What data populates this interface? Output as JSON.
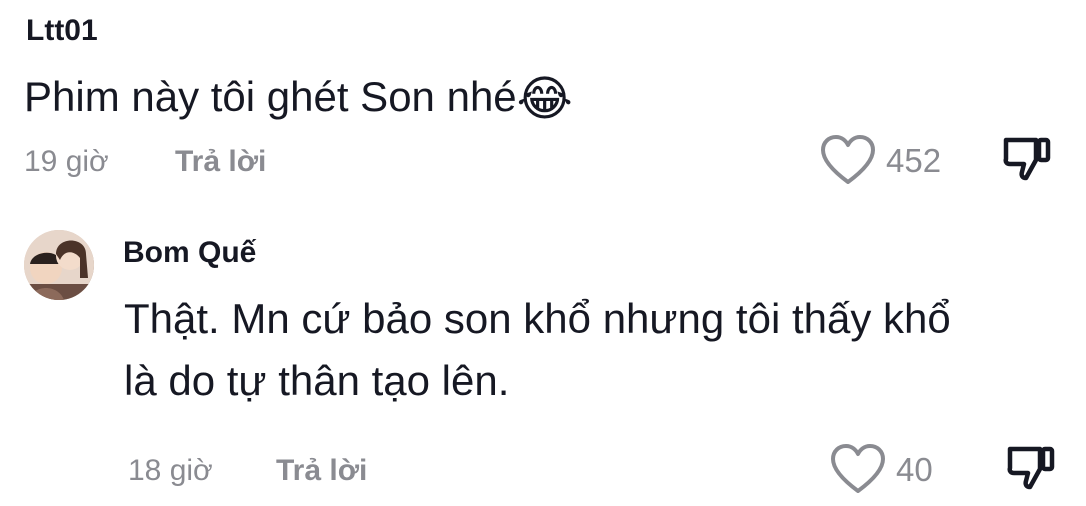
{
  "comments": [
    {
      "username": "Ltt01",
      "text": "Phim này tôi ghét Son nhé",
      "emoji": "😂",
      "time": "19 giờ",
      "reply_label": "Trả lời",
      "likes": "452"
    },
    {
      "username": "Bom Quế",
      "text_line1": "Thật. Mn cứ bảo son khổ nhưng tôi thấy khổ",
      "text_line2": "là do tự thân tạo lên.",
      "time": "18 giờ",
      "reply_label": "Trả lời",
      "likes": "40"
    }
  ],
  "icons": {
    "like": "heart-outline-icon",
    "dislike": "thumbs-down-icon"
  },
  "colors": {
    "text": "#161823",
    "secondary": "#8a8b91"
  }
}
